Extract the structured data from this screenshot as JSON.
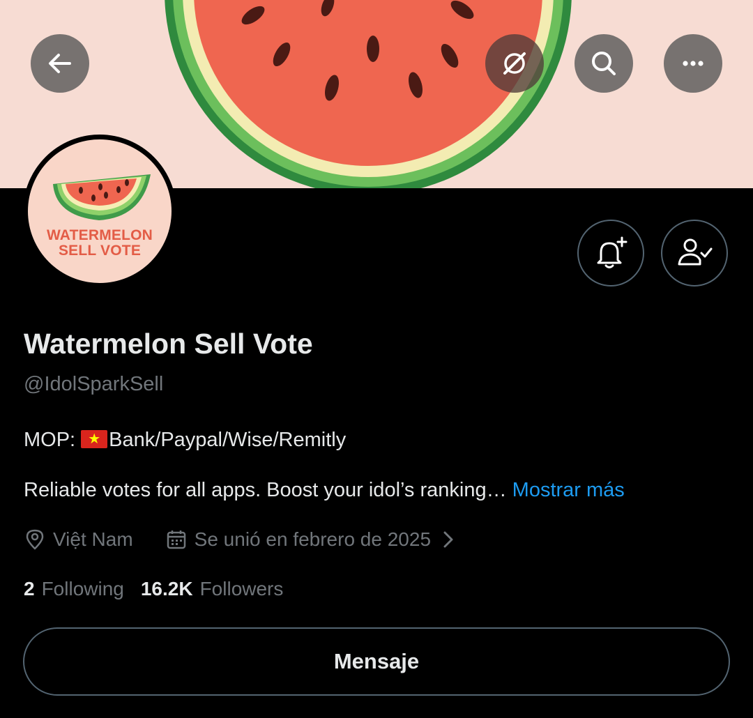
{
  "header": {
    "back_icon": "arrow-left-icon",
    "grok_icon": "grok-icon",
    "search_icon": "search-icon",
    "more_icon": "more-horizontal-icon"
  },
  "avatar": {
    "line1": "WATERMELON",
    "line2": "SELL VOTE"
  },
  "profile": {
    "display_name": "Watermelon Sell Vote",
    "handle": "@IdolSparkSell",
    "bio_line1_prefix": "MOP: ",
    "bio_line1_flag": "vietnam-flag",
    "bio_line1_rest": "Bank/Paypal/Wise/Remitly",
    "bio_line2": "Reliable votes for all apps. Boost your idol’s ranking… ",
    "show_more": "Mostrar más",
    "location": "Việt Nam",
    "joined": "Se unió en febrero de 2025"
  },
  "stats": {
    "following_count": "2",
    "following_label": "Following",
    "followers_count": "16.2K",
    "followers_label": "Followers"
  },
  "actions": {
    "message_label": "Mensaje",
    "notify_icon": "bell-plus-icon",
    "following_icon": "person-check-icon"
  },
  "colors": {
    "background": "#000000",
    "text_primary": "#e7e9ea",
    "text_secondary": "#71767b",
    "link": "#1d9bf0",
    "banner_bg": "#f7dcd3",
    "watermelon_flesh": "#ef6650",
    "watermelon_rind": "#3f9b4a"
  }
}
